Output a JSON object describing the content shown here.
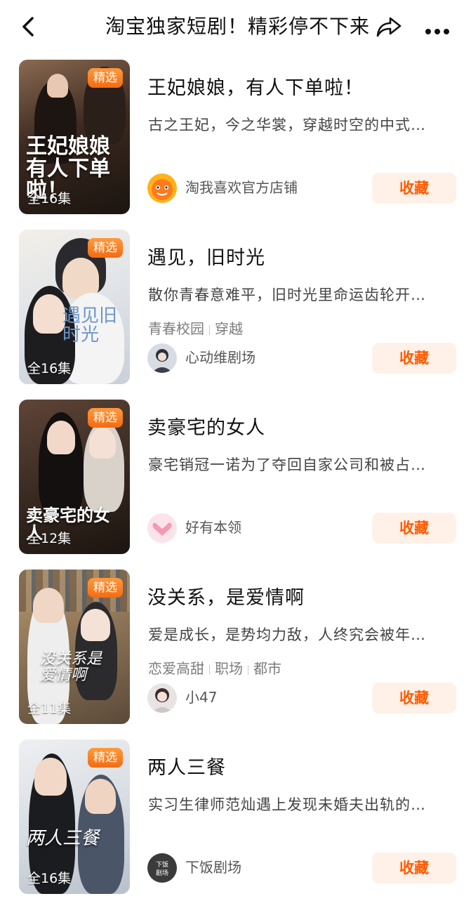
{
  "header": {
    "title": "淘宝独家短剧！精彩停不下来",
    "back_icon": "chevron-left-icon",
    "share_icon": "share-icon",
    "more_icon": "more-dots-icon"
  },
  "common": {
    "badge_label": "精选",
    "fav_label": "收藏"
  },
  "dramas": [
    {
      "title": "王妃娘娘，有人下单啦！",
      "desc": "古之王妃，今之华裳，穿越时空的中式…",
      "tags": [],
      "shop": "淘我喜欢官方店铺",
      "episodes": "全16集",
      "poster_title": "王妃娘娘有人下单啦！"
    },
    {
      "title": "遇见，旧时光",
      "desc": "散你青春意难平，旧时光里命运齿轮开…",
      "tags": [
        "青春校园",
        "穿越"
      ],
      "shop": "心动维剧场",
      "episodes": "全16集",
      "poster_title": "遇见旧时光"
    },
    {
      "title": "卖豪宅的女人",
      "desc": "豪宅销冠一诺为了夺回自家公司和被占…",
      "tags": [],
      "shop": "好有本领",
      "episodes": "全12集",
      "poster_title": "卖豪宅的女人"
    },
    {
      "title": "没关系，是爱情啊",
      "desc": "爱是成长，是势均力敌，人终究会被年…",
      "tags": [
        "恋爱高甜",
        "职场",
        "都市"
      ],
      "shop": "小47",
      "episodes": "全11集",
      "poster_title": "没关系是爱情啊"
    },
    {
      "title": "两人三餐",
      "desc": "实习生律师范灿遇上发现未婚夫出轨的…",
      "tags": [],
      "shop": "下饭剧场",
      "episodes": "全16集",
      "poster_title": "两人三餐"
    }
  ],
  "logo_text": {
    "shop5": "下饭剧场"
  }
}
